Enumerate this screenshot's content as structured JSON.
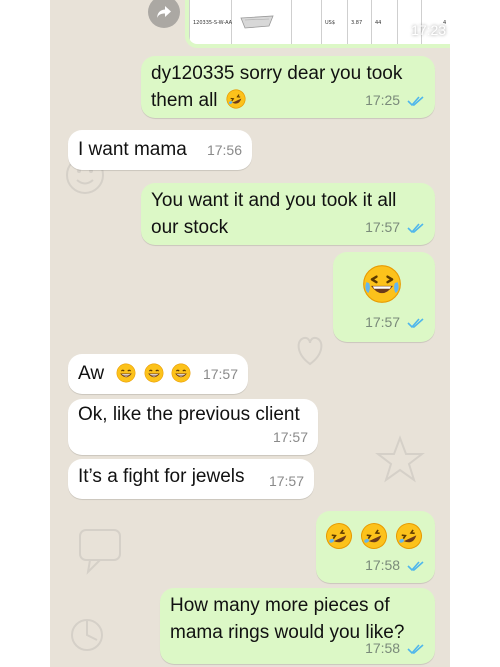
{
  "messages": [
    {
      "id": "m0",
      "direction": "outgoing",
      "type": "image",
      "time": "17:23",
      "image_cells": [
        "120335-S-W-AA",
        "US$",
        "3.87",
        "44",
        "4"
      ]
    },
    {
      "id": "m1",
      "direction": "outgoing",
      "text_line1": "dy120335 sorry dear you took",
      "text_line2": "them all",
      "emoji": "rofl",
      "time": "17:25"
    },
    {
      "id": "m2",
      "direction": "incoming",
      "text": "I want mama",
      "time": "17:56"
    },
    {
      "id": "m3",
      "direction": "outgoing",
      "text_line1": "You want it and you took it all",
      "text_line2": "our stock",
      "time": "17:57"
    },
    {
      "id": "m4",
      "direction": "outgoing",
      "emoji": "joy",
      "time": "17:57"
    },
    {
      "id": "m5",
      "direction": "incoming",
      "text": "Aw",
      "emojis": [
        "grin",
        "grin",
        "grin"
      ],
      "time": "17:57"
    },
    {
      "id": "m6",
      "direction": "incoming",
      "text": "Ok, like the previous client",
      "time": "17:57"
    },
    {
      "id": "m7",
      "direction": "incoming",
      "text": "It’s a fight for jewels",
      "time": "17:57"
    },
    {
      "id": "m8",
      "direction": "outgoing",
      "emojis": [
        "rofl",
        "rofl",
        "rofl"
      ],
      "time": "17:58"
    },
    {
      "id": "m9",
      "direction": "outgoing",
      "text_line1": "How many more pieces of",
      "text_line2": "mama rings would you like?",
      "time": "17:58"
    }
  ],
  "colors": {
    "outgoing_bubble": "#dcf8c6",
    "incoming_bubble": "#ffffff",
    "wallpaper": "#e8e2d8",
    "read_ticks": "#4fb6ec"
  },
  "icons": [
    "forward-icon",
    "double-check-icon",
    "rofl-emoji",
    "joy-emoji",
    "grin-emoji"
  ]
}
